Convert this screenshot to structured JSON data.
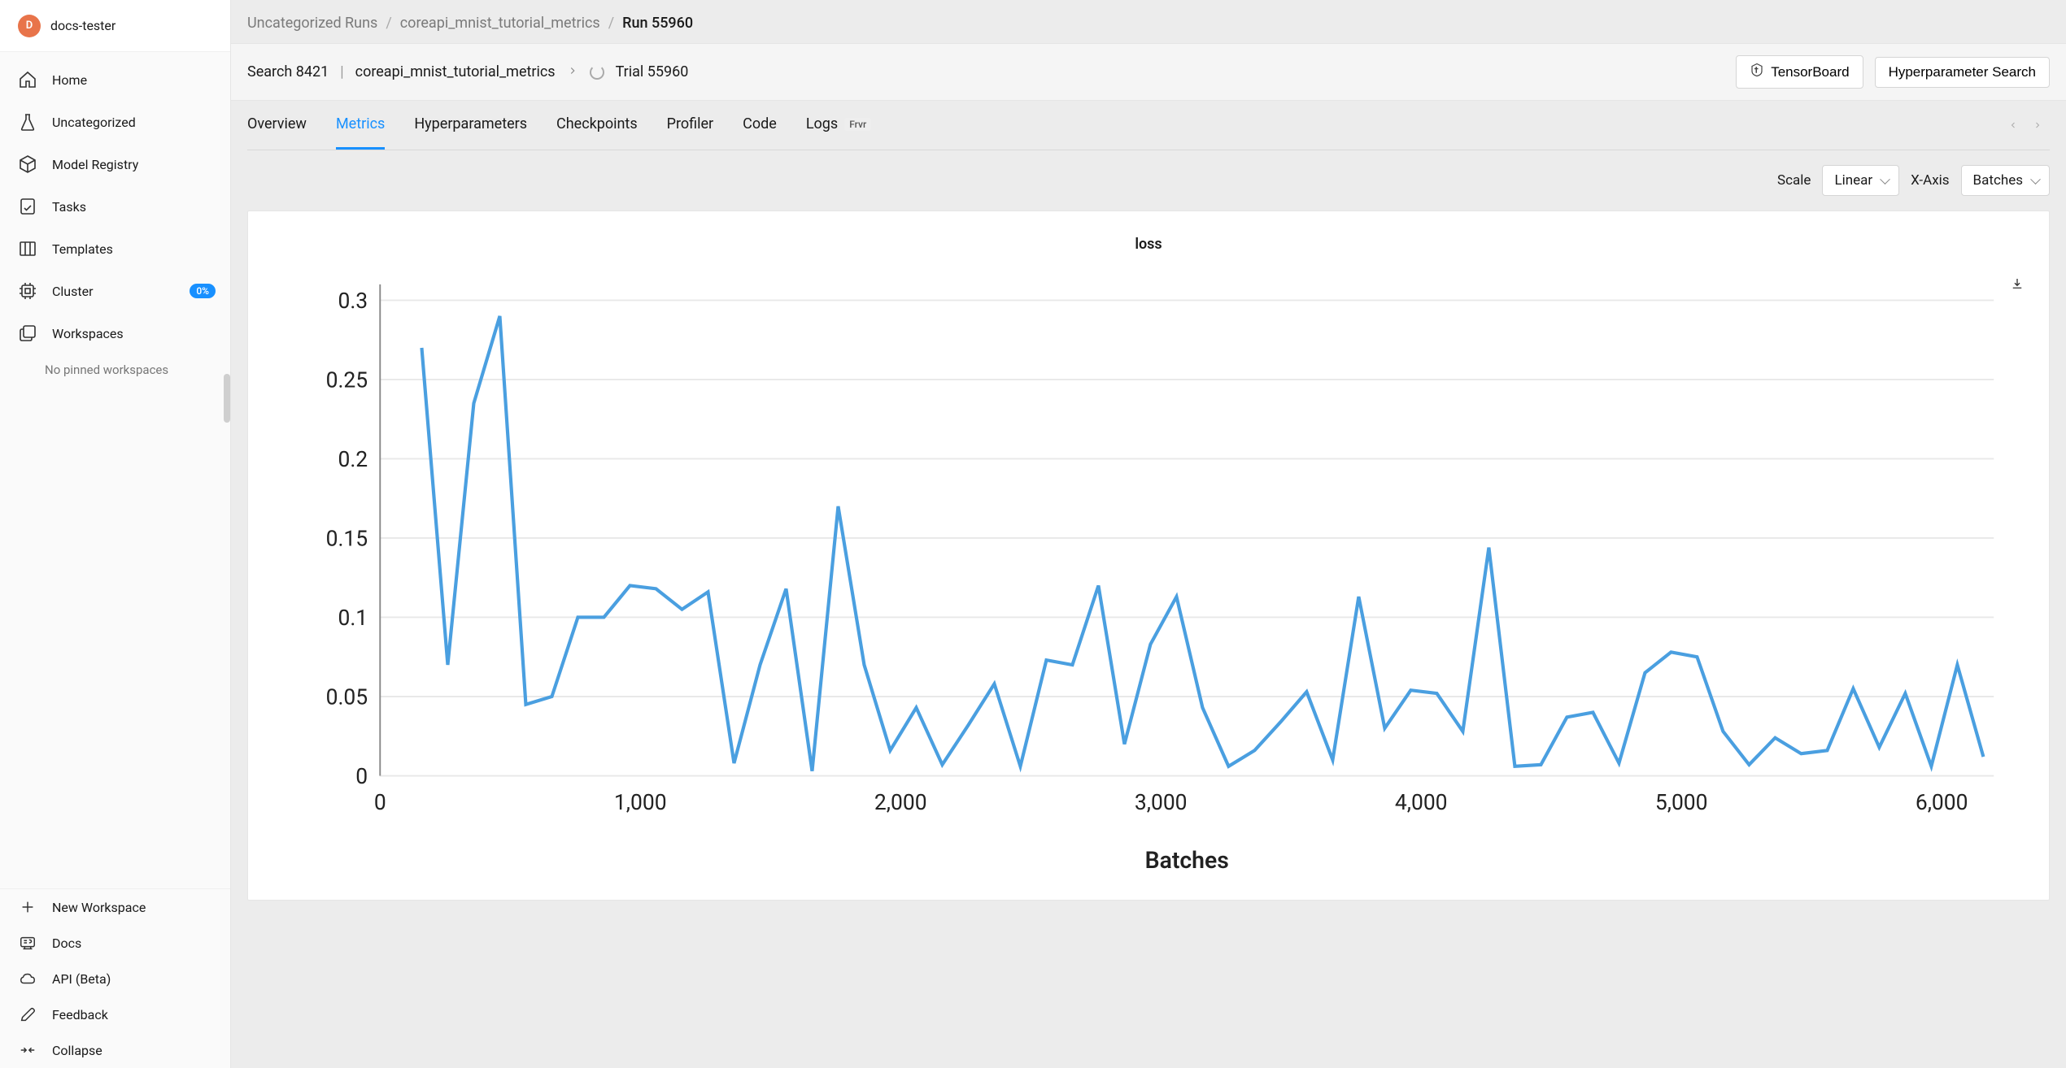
{
  "user": {
    "initial": "D",
    "name": "docs-tester"
  },
  "sidebar": {
    "items": [
      {
        "label": "Home"
      },
      {
        "label": "Uncategorized"
      },
      {
        "label": "Model Registry"
      },
      {
        "label": "Tasks"
      },
      {
        "label": "Templates"
      },
      {
        "label": "Cluster",
        "badge": "0%"
      },
      {
        "label": "Workspaces"
      }
    ],
    "no_pinned": "No pinned workspaces",
    "bottom": [
      {
        "label": "New Workspace"
      },
      {
        "label": "Docs"
      },
      {
        "label": "API (Beta)"
      },
      {
        "label": "Feedback"
      },
      {
        "label": "Collapse"
      }
    ]
  },
  "breadcrumb": {
    "items": [
      "Uncategorized Runs",
      "coreapi_mnist_tutorial_metrics"
    ],
    "current": "Run 55960"
  },
  "toolbar": {
    "search_label": "Search 8421",
    "experiment_name": "coreapi_mnist_tutorial_metrics",
    "trial_label": "Trial 55960",
    "tensorboard_btn": "TensorBoard",
    "hp_search_btn": "Hyperparameter Search"
  },
  "tabs": [
    {
      "label": "Overview"
    },
    {
      "label": "Metrics",
      "active": true
    },
    {
      "label": "Hyperparameters"
    },
    {
      "label": "Checkpoints"
    },
    {
      "label": "Profiler"
    },
    {
      "label": "Code"
    },
    {
      "label": "Logs",
      "badge": "Frvr"
    }
  ],
  "controls": {
    "scale_label": "Scale",
    "scale_value": "Linear",
    "xaxis_label": "X-Axis",
    "xaxis_value": "Batches"
  },
  "chart_data": {
    "type": "line",
    "title": "loss",
    "xlabel": "Batches",
    "ylabel": "",
    "xlim": [
      0,
      6200
    ],
    "ylim": [
      0,
      0.31
    ],
    "xticks": [
      0,
      1000,
      2000,
      3000,
      4000,
      5000,
      6000
    ],
    "xtick_labels": [
      "0",
      "1,000",
      "2,000",
      "3,000",
      "4,000",
      "5,000",
      "6,000"
    ],
    "yticks": [
      0,
      0.05,
      0.1,
      0.15,
      0.2,
      0.25,
      0.3
    ],
    "series": [
      {
        "name": "loss",
        "color": "#4a9fe0",
        "x": [
          160,
          260,
          360,
          460,
          560,
          660,
          760,
          860,
          960,
          1060,
          1160,
          1260,
          1360,
          1460,
          1560,
          1660,
          1760,
          1860,
          1960,
          2060,
          2160,
          2260,
          2360,
          2460,
          2560,
          2660,
          2760,
          2860,
          2960,
          3060,
          3160,
          3260,
          3360,
          3460,
          3560,
          3660,
          3760,
          3860,
          3960,
          4060,
          4160,
          4260,
          4360,
          4460,
          4560,
          4660,
          4760,
          4860,
          4960,
          5060,
          5160,
          5260,
          5360,
          5460,
          5560,
          5660,
          5760,
          5860,
          5960,
          6060,
          6160
        ],
        "y": [
          0.27,
          0.07,
          0.235,
          0.29,
          0.045,
          0.05,
          0.1,
          0.1,
          0.12,
          0.118,
          0.105,
          0.116,
          0.008,
          0.07,
          0.118,
          0.003,
          0.17,
          0.07,
          0.016,
          0.043,
          0.007,
          0.032,
          0.058,
          0.006,
          0.073,
          0.07,
          0.12,
          0.02,
          0.083,
          0.113,
          0.043,
          0.006,
          0.016,
          0.034,
          0.053,
          0.01,
          0.113,
          0.03,
          0.054,
          0.052,
          0.028,
          0.144,
          0.006,
          0.007,
          0.037,
          0.04,
          0.008,
          0.065,
          0.078,
          0.075,
          0.028,
          0.007,
          0.024,
          0.014,
          0.016,
          0.055,
          0.018,
          0.052,
          0.006,
          0.07,
          0.012
        ]
      }
    ]
  }
}
